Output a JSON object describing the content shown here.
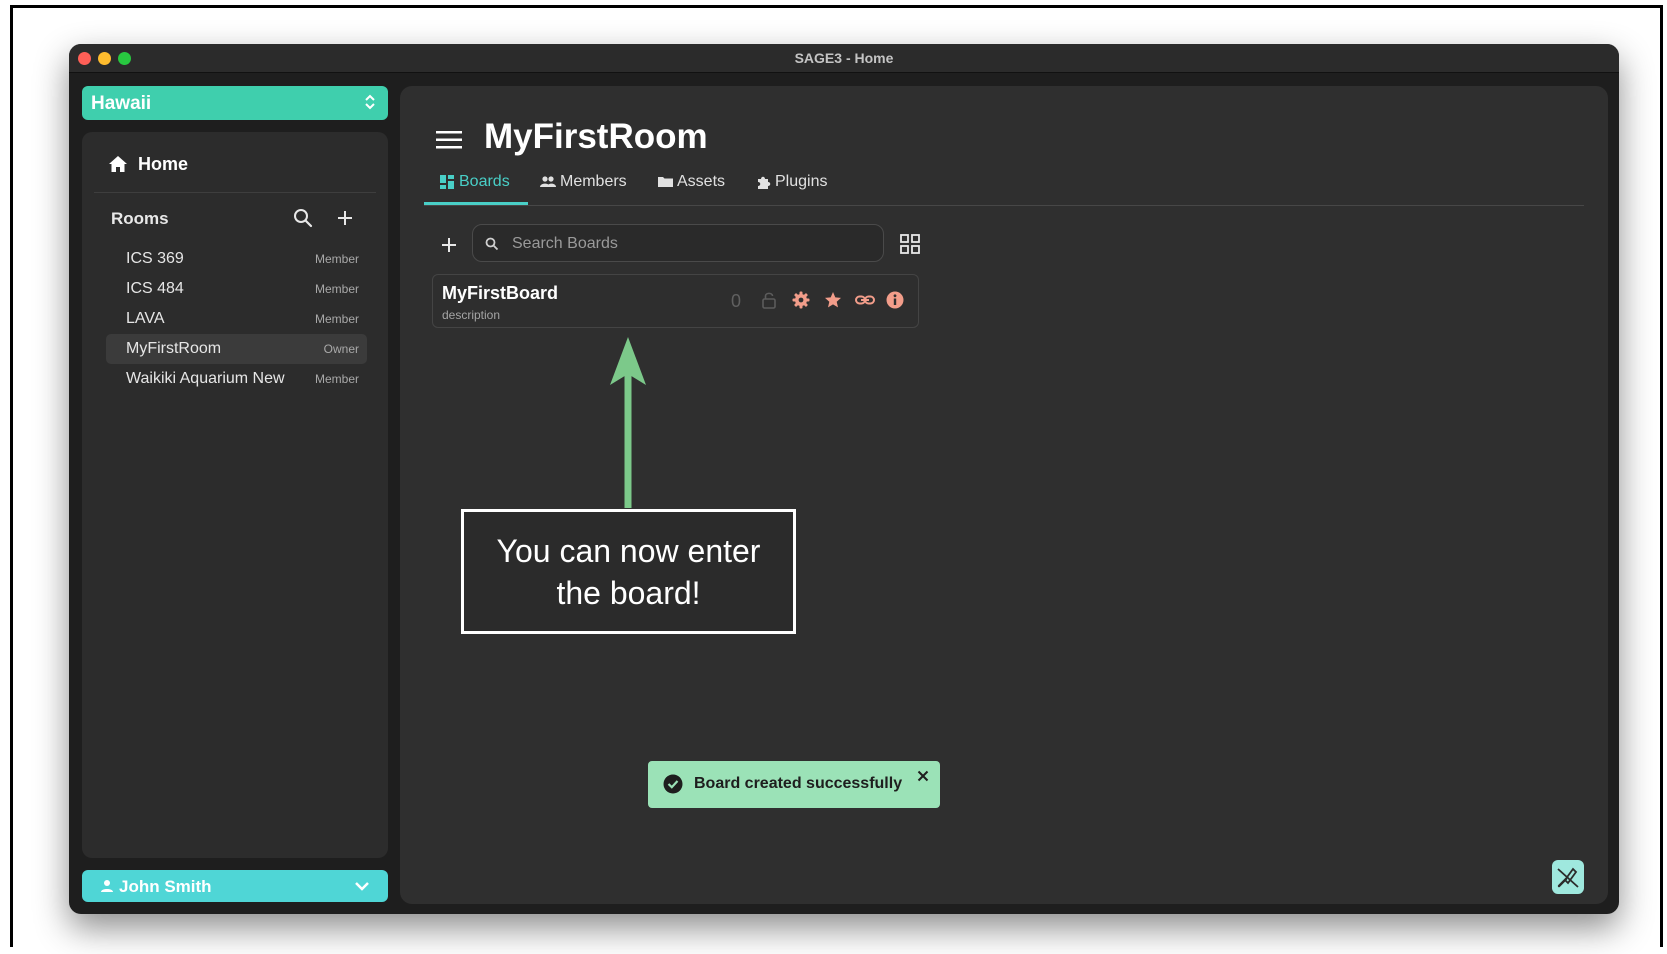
{
  "window": {
    "title": "SAGE3 - Home"
  },
  "sidebar": {
    "org": "Hawaii",
    "home_label": "Home",
    "rooms_header": "Rooms",
    "rooms": [
      {
        "name": "ICS 369",
        "role": "Member"
      },
      {
        "name": "ICS 484",
        "role": "Member"
      },
      {
        "name": "LAVA",
        "role": "Member"
      },
      {
        "name": "MyFirstRoom",
        "role": "Owner"
      },
      {
        "name": "Waikiki Aquarium New",
        "role": "Member"
      }
    ],
    "user": "John Smith"
  },
  "main": {
    "room_title": "MyFirstRoom",
    "tabs": [
      {
        "label": "Boards"
      },
      {
        "label": "Members"
      },
      {
        "label": "Assets"
      },
      {
        "label": "Plugins"
      }
    ],
    "search": {
      "placeholder": "Search Boards"
    },
    "boards": [
      {
        "name": "MyFirstBoard",
        "description": "description",
        "count": "0"
      }
    ]
  },
  "annotation": {
    "line1": "You can now enter",
    "line2": "the board!"
  },
  "toast": {
    "message": "Board created successfully"
  },
  "colors": {
    "org_accent": "#3fcfad",
    "user_accent": "#4fd6d6",
    "tab_active": "#49cfc7",
    "board_icon": "#f29d8a",
    "toast_bg": "#9be2b7",
    "arrow": "#7cc98a"
  }
}
